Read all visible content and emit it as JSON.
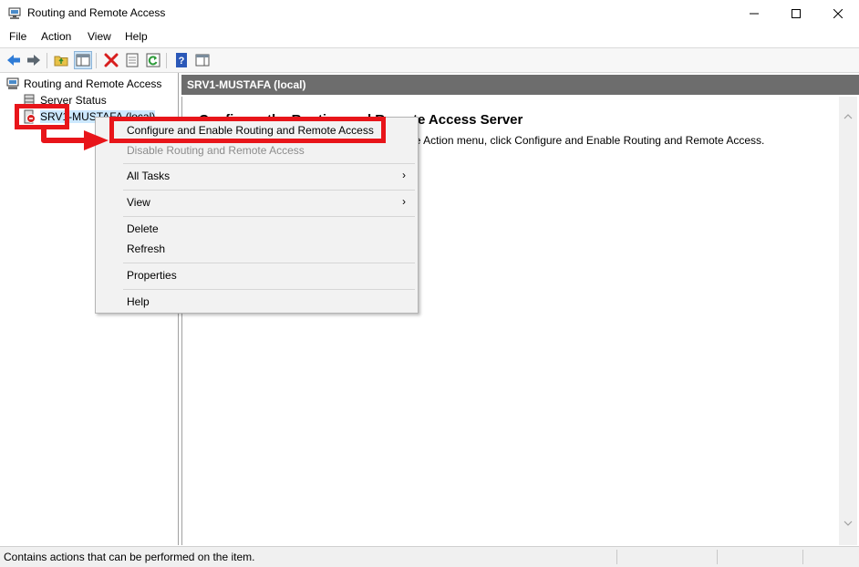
{
  "window": {
    "title": "Routing and Remote Access",
    "minimize_icon": "minimize-icon",
    "maximize_icon": "maximize-icon",
    "close_icon": "close-icon"
  },
  "menubar": {
    "items": [
      "File",
      "Action",
      "View",
      "Help"
    ]
  },
  "toolbar": {
    "buttons": [
      "back-arrow-icon",
      "forward-arrow-icon",
      "up-folder-icon",
      "show-hide-tree-icon",
      "delete-icon",
      "properties-icon",
      "refresh-icon",
      "help-icon",
      "action-pane-icon"
    ]
  },
  "tree": {
    "root": "Routing and Remote Access",
    "children": [
      "Server Status",
      "SRV1-MUSTAFA (local)"
    ]
  },
  "detail": {
    "header": "SRV1-MUSTAFA (local)",
    "heading": "Configure the Routing and Remote Access Server",
    "text": "To set up Routing and Remote Access, on the Action menu, click Configure and Enable Routing and Remote Access."
  },
  "context_menu": {
    "items": [
      {
        "label": "Configure and Enable Routing and Remote Access",
        "enabled": true
      },
      {
        "label": "Disable Routing and Remote Access",
        "enabled": false
      },
      {
        "label": "All Tasks",
        "submenu": true
      },
      {
        "label": "View",
        "submenu": true
      },
      {
        "label": "Delete"
      },
      {
        "label": "Refresh"
      },
      {
        "label": "Properties"
      },
      {
        "label": "Help"
      }
    ],
    "submenu_arrow": "›"
  },
  "statusbar": {
    "text": "Contains actions that can be performed on the item."
  },
  "colors": {
    "annotation_red": "#e8151a",
    "header_gray": "#6d6d6d",
    "selection_blue": "#cce8ff"
  }
}
